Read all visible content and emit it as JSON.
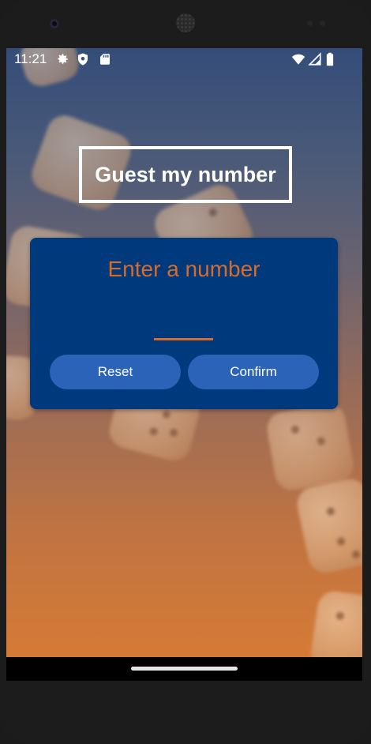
{
  "status_bar": {
    "time": "11:21",
    "left_icons": [
      "gear-icon",
      "shield-icon",
      "sd-card-icon"
    ],
    "right_icons": [
      "wifi-icon",
      "cell-signal-icon",
      "battery-icon"
    ]
  },
  "app": {
    "title": "Guest my number",
    "prompt": "Enter a number",
    "input_value": "",
    "reset_label": "Reset",
    "confirm_label": "Confirm"
  },
  "colors": {
    "card": "#003a7d",
    "accent": "#d76b2a",
    "button": "#2b63b8"
  }
}
